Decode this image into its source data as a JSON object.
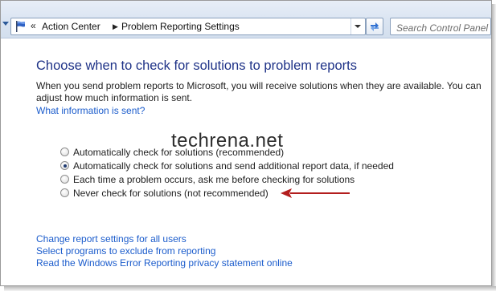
{
  "colors": {
    "heading": "#1e3287",
    "link": "#1b5ccc",
    "annotation_arrow": "#b31d1d",
    "toolbar_bg": "#dbe5f2"
  },
  "address_bar": {
    "icon": "control-panel-flag-icon",
    "overflow": "«",
    "breadcrumbs": [
      "Action Center",
      "Problem Reporting Settings"
    ]
  },
  "search": {
    "placeholder": "Search Control Panel"
  },
  "main": {
    "heading": "Choose when to check for solutions to problem reports",
    "description": "When you send problem reports to Microsoft, you will receive solutions when they are available. You can adjust how much information is sent.",
    "info_link": "What information is sent?",
    "watermark": "techrena.net",
    "options": [
      {
        "label": "Automatically check for solutions (recommended)",
        "selected": false
      },
      {
        "label": "Automatically check for solutions and send additional report data, if needed",
        "selected": true
      },
      {
        "label": "Each time a problem occurs, ask me before checking for solutions",
        "selected": false
      },
      {
        "label": "Never check for solutions (not recommended)",
        "selected": false
      }
    ],
    "links": [
      "Change report settings for all users",
      "Select programs to exclude from reporting",
      "Read the Windows Error Reporting privacy statement online"
    ]
  }
}
